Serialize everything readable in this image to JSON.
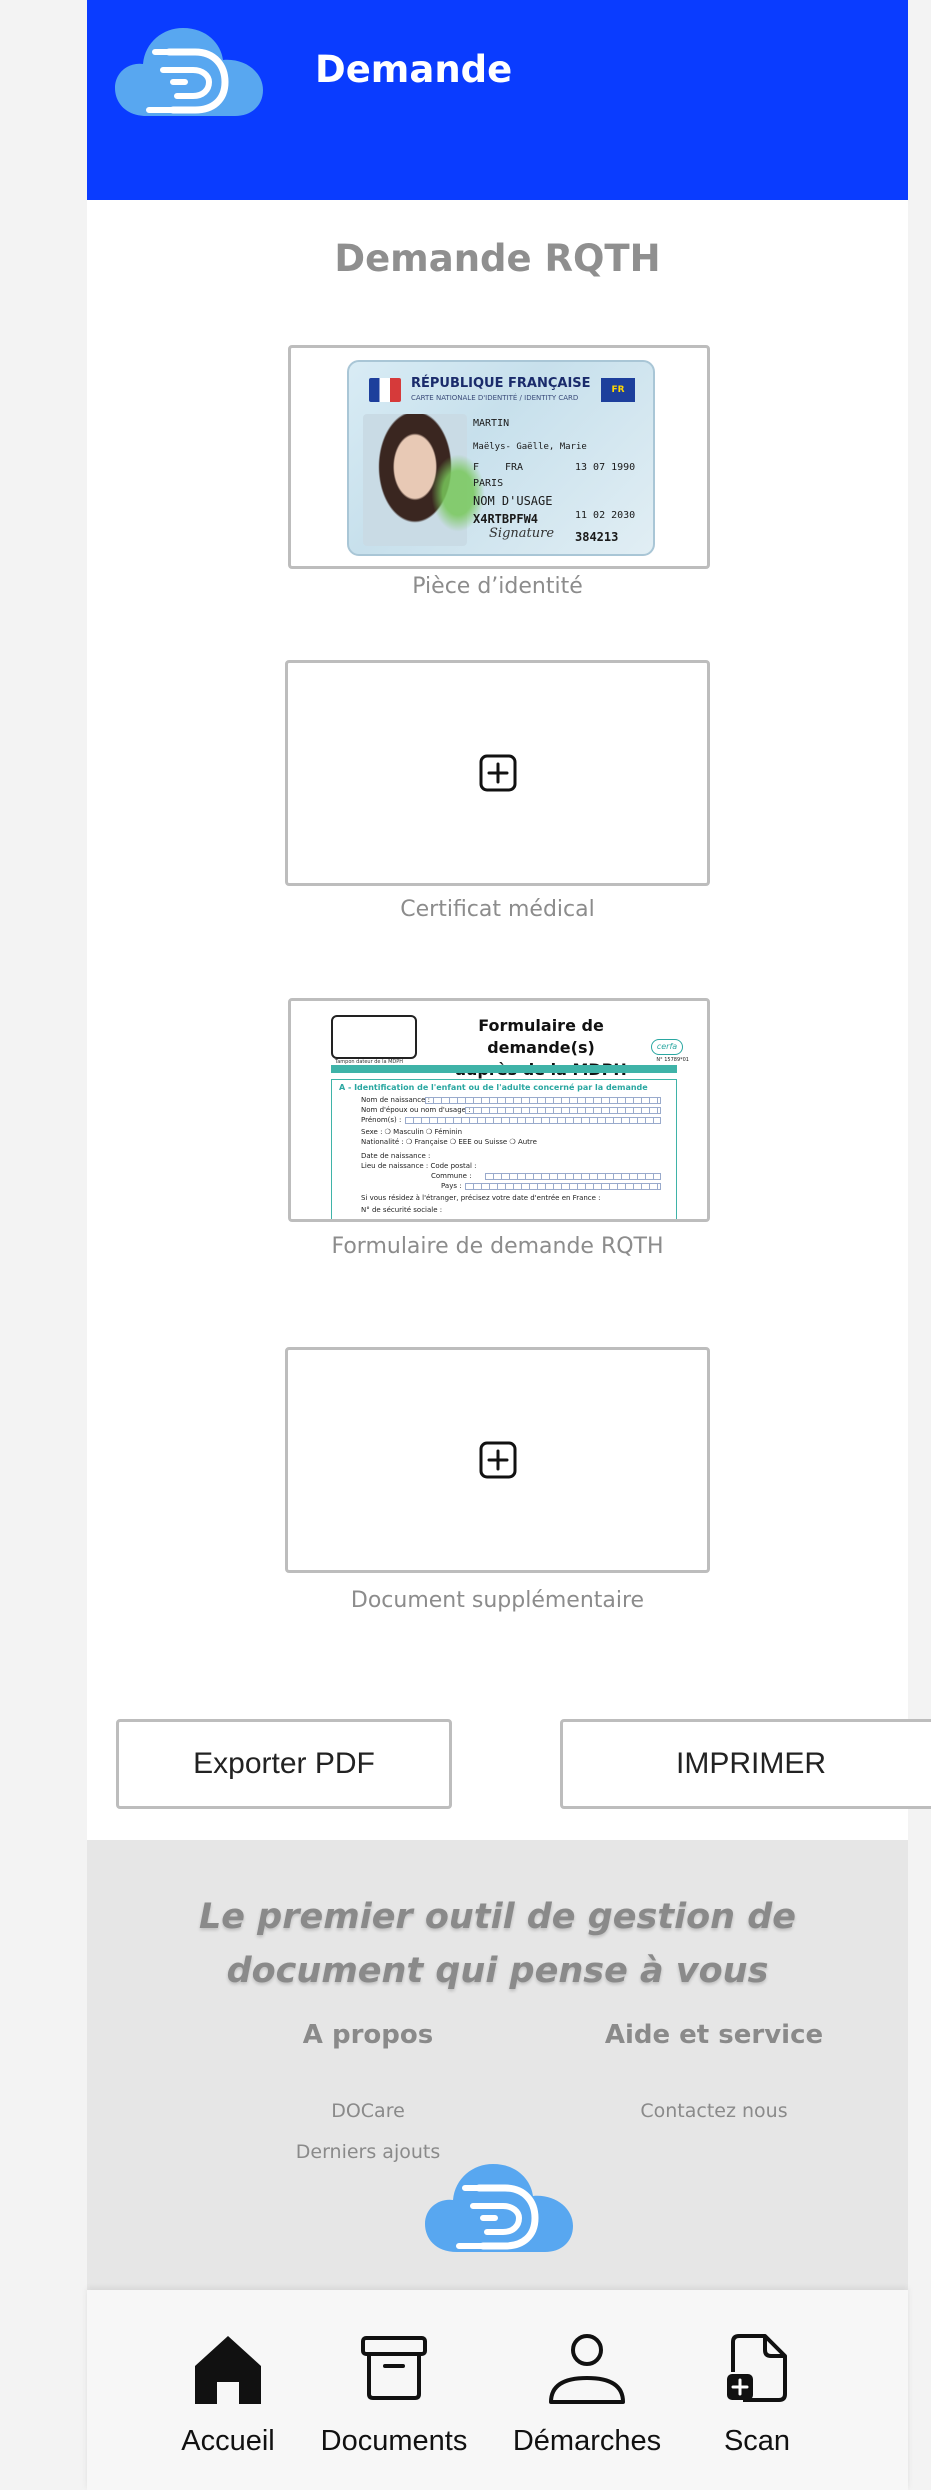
{
  "header": {
    "title": "Demande",
    "brand_color": "#0a3cff",
    "logo": "cloud-d-logo-icon"
  },
  "page": {
    "title": "Demande RQTH"
  },
  "documents": [
    {
      "label": "Pièce d’identité",
      "state": "filled",
      "preview": "id-card"
    },
    {
      "label": "Certificat médical",
      "state": "empty",
      "icon": "plus-square-icon"
    },
    {
      "label": "Formulaire de demande RQTH",
      "state": "filled",
      "preview": "form"
    },
    {
      "label": "Document supplémentaire",
      "state": "empty",
      "icon": "plus-square-icon"
    }
  ],
  "id_card": {
    "country": "RÉPUBLIQUE FRANÇAISE",
    "subtitle": "CARTE NATIONALE D'IDENTITÉ / IDENTITY CARD",
    "eu": "FR",
    "surname": "MARTIN",
    "given_names": "Maëlys- Gaëlle, Marie",
    "sex": "F",
    "nationality": "FRA",
    "birth_date": "13 07 1990",
    "birth_place": "PARIS",
    "usage_name": "NOM D'USAGE",
    "document_no": "X4RTBPFW4",
    "expiry": "11 02 2030",
    "can": "384213",
    "signature": "Signature"
  },
  "form_preview": {
    "title_line1": "Formulaire de demande(s)",
    "title_line2": "auprès de la MDPH",
    "cerfa": "cerfa",
    "cerfa_no": "N° 15789*01",
    "stamp_caption": "Tampon dateur de la MDPH",
    "section_a": "A - Identification de l'enfant ou de l'adulte concerné par la demande",
    "rows": [
      "Nom de naissance :",
      "Nom d'époux ou nom d'usage :",
      "Prénom(s) :",
      "Sexe :   ❍ Masculin   ❍ Féminin",
      "Nationalité : ❍ Française   ❍ EEE ou Suisse   ❍ Autre",
      "Date de naissance :",
      "Lieu de naissance :   Code postal :",
      "Commune :",
      "Pays :",
      "Si vous résidez à l'étranger, précisez votre date d'entrée en France :",
      "N° de sécurité sociale :"
    ]
  },
  "actions": {
    "export_label": "Exporter PDF",
    "print_label": "IMPRIMER"
  },
  "footer": {
    "tagline": "Le  premier outil de gestion de document qui pense à vous",
    "about_title": "A propos",
    "about_links": [
      "DOCare",
      "Derniers ajouts"
    ],
    "help_title": "Aide et service",
    "help_links": [
      "Contactez nous"
    ]
  },
  "nav": {
    "items": [
      {
        "label": "Accueil",
        "icon": "home-icon"
      },
      {
        "label": "Documents",
        "icon": "archive-icon"
      },
      {
        "label": "Démarches",
        "icon": "user-icon"
      },
      {
        "label": "Scan",
        "icon": "file-plus-icon"
      }
    ]
  }
}
